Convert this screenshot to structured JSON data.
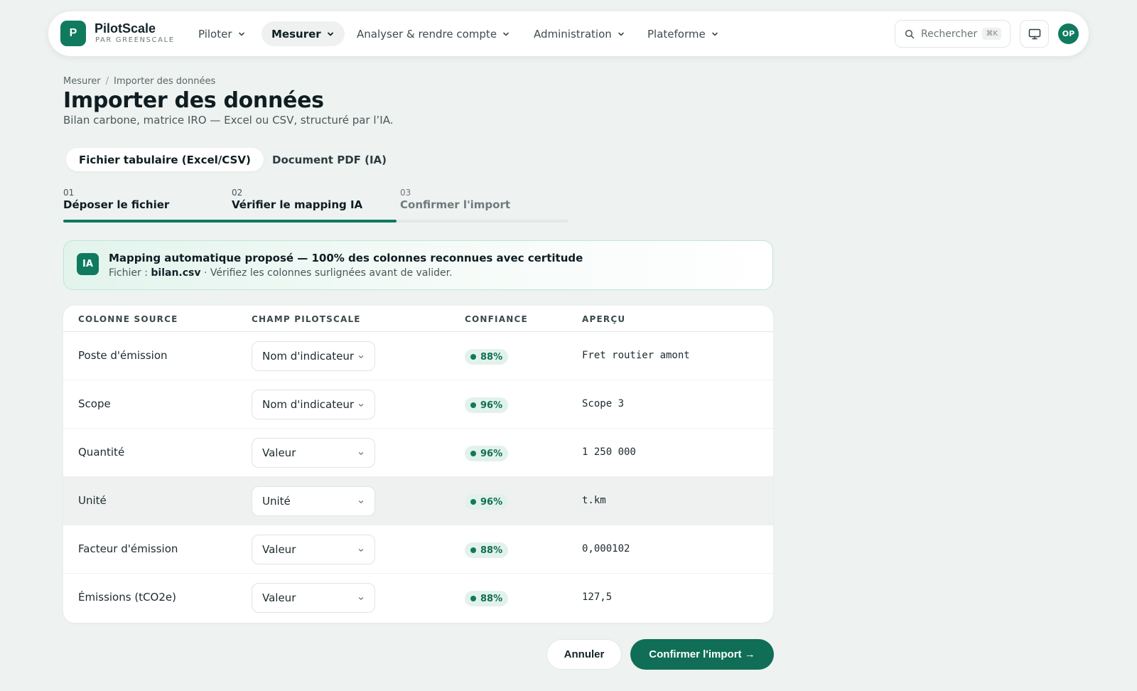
{
  "brand": {
    "logo_letter": "P",
    "name": "PilotScale",
    "sub": "PAR GREENSCALE"
  },
  "nav": [
    {
      "label": "Piloter",
      "active": false
    },
    {
      "label": "Mesurer",
      "active": true
    },
    {
      "label": "Analyser & rendre compte",
      "active": false
    },
    {
      "label": "Administration",
      "active": false
    },
    {
      "label": "Plateforme",
      "active": false
    }
  ],
  "search": {
    "placeholder": "Rechercher",
    "shortcut": "⌘K"
  },
  "user": {
    "initials": "OP"
  },
  "breadcrumb": {
    "parent": "Mesurer",
    "separator": "/",
    "current": "Importer des données"
  },
  "page": {
    "title": "Importer des données",
    "subtitle": "Bilan carbone, matrice IRO — Excel ou CSV, structuré par l’IA."
  },
  "tabs": [
    {
      "label": "Fichier tabulaire (Excel/CSV)",
      "active": true
    },
    {
      "label": "Document PDF (IA)",
      "active": false
    }
  ],
  "steps": [
    {
      "num": "01",
      "label": "Déposer le fichier",
      "state": "done"
    },
    {
      "num": "02",
      "label": "Vérifier le mapping IA",
      "state": "current"
    },
    {
      "num": "03",
      "label": "Confirmer l'import",
      "state": "todo"
    }
  ],
  "step_progress_fraction": 0.66,
  "ai_banner": {
    "badge": "IA",
    "title": "Mapping automatique proposé — 100% des colonnes reconnues avec certitude",
    "file_prefix": "Fichier : ",
    "file_name": "bilan.csv",
    "file_suffix": " · Vérifiez les colonnes surlignées avant de valider."
  },
  "table": {
    "headers": [
      "COLONNE SOURCE",
      "CHAMP PILOTSCALE",
      "CONFIANCE",
      "APERÇU"
    ],
    "rows": [
      {
        "source": "Poste d'émission",
        "field": "Nom d'indicateur",
        "confidence": "88%",
        "preview": "Fret routier amont",
        "highlight": false
      },
      {
        "source": "Scope",
        "field": "Nom d'indicateur",
        "confidence": "96%",
        "preview": "Scope 3",
        "highlight": false
      },
      {
        "source": "Quantité",
        "field": "Valeur",
        "confidence": "96%",
        "preview": "1 250 000",
        "highlight": false
      },
      {
        "source": "Unité",
        "field": "Unité",
        "confidence": "96%",
        "preview": "t.km",
        "highlight": true
      },
      {
        "source": "Facteur d'émission",
        "field": "Valeur",
        "confidence": "88%",
        "preview": "0,000102",
        "highlight": false
      },
      {
        "source": "Émissions (tCO2e)",
        "field": "Valeur",
        "confidence": "88%",
        "preview": "127,5",
        "highlight": false
      }
    ]
  },
  "actions": {
    "cancel": "Annuler",
    "confirm": "Confirmer l'import →"
  },
  "colors": {
    "accent": "#0f7a5e",
    "accent_dark": "#0f6e55",
    "background": "#eef2f0"
  }
}
